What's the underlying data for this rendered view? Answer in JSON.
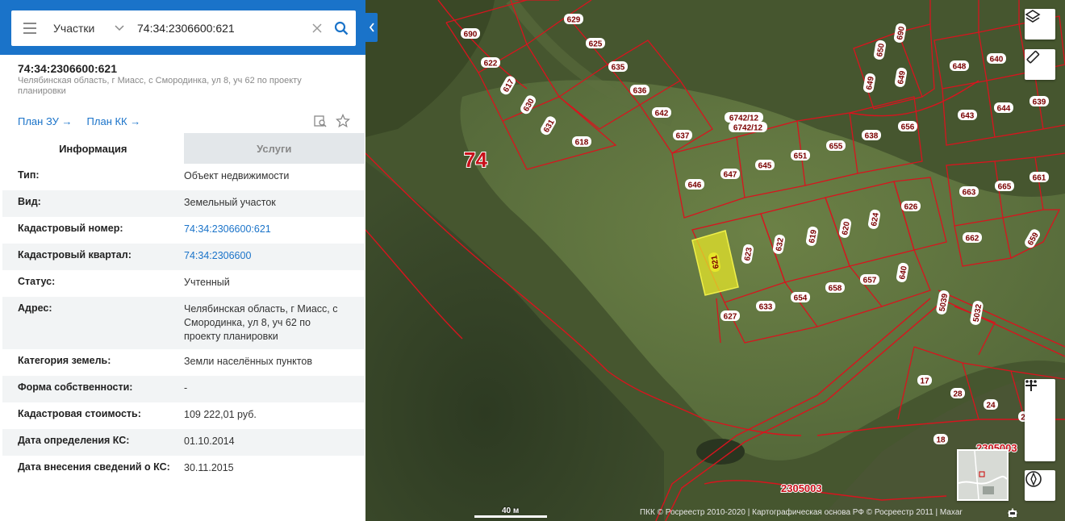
{
  "search": {
    "category": "Участки",
    "query": "74:34:2306600:621"
  },
  "object": {
    "number": "74:34:2306600:621",
    "address": "Челябинская область, г Миасс, с Смородинка, ул 8, уч 62 по проекту планировки",
    "link_zu": "План ЗУ →",
    "link_kk": "План КК →"
  },
  "tabs": {
    "info": "Информация",
    "services": "Услуги"
  },
  "rows": [
    {
      "key": "Тип:",
      "value": "Объект недвижимости"
    },
    {
      "key": "Вид:",
      "value": "Земельный участок"
    },
    {
      "key": "Кадастровый номер:",
      "value": "74:34:2306600:621"
    },
    {
      "key": "Кадастровый квартал:",
      "value": "74:34:2306600"
    },
    {
      "key": "Статус:",
      "value": "Учтенный"
    },
    {
      "key": "Адрес:",
      "value": "Челябинская область, г Миасс, с Смородинка, ул 8, уч 62 по проекту планировки"
    },
    {
      "key": "Категория земель:",
      "value": "Земли населённых пунктов"
    },
    {
      "key": "Форма собственности:",
      "value": "-"
    },
    {
      "key": "Кадастровая стоимость:",
      "value": "109 222,01 руб."
    },
    {
      "key": "Дата определения КС:",
      "value": "01.10.2014"
    },
    {
      "key": "Дата внесения сведений о КС:",
      "value": "30.11.2015"
    }
  ],
  "map": {
    "region_label": "74",
    "quarter_labels": [
      "2305003",
      "2305003"
    ],
    "parcel_labels": [
      "629",
      "690",
      "625",
      "622",
      "635",
      "617",
      "636",
      "630",
      "642",
      "631",
      "637",
      "618",
      "646",
      "647",
      "645",
      "651",
      "655",
      "638",
      "656",
      "648",
      "640",
      "643",
      "644",
      "639",
      "650",
      "690",
      "649",
      "649",
      "663",
      "665",
      "661",
      "662",
      "659",
      "626",
      "624",
      "620",
      "619",
      "632",
      "623",
      "621",
      "640",
      "657",
      "658",
      "654",
      "633",
      "627",
      "5039",
      "5032",
      "17",
      "28",
      "24",
      "2",
      "18",
      "6742/12",
      "6742/12"
    ],
    "scale": "40 м",
    "attribution": "ПКК © Росреестр 2010-2020 | Картографическая основа РФ © Росреестр 2011 | Maxar",
    "colors": {
      "parcel_border": "#d8141e",
      "selected_fill": "#e6e62a",
      "label_bg": "#ffffff"
    }
  }
}
